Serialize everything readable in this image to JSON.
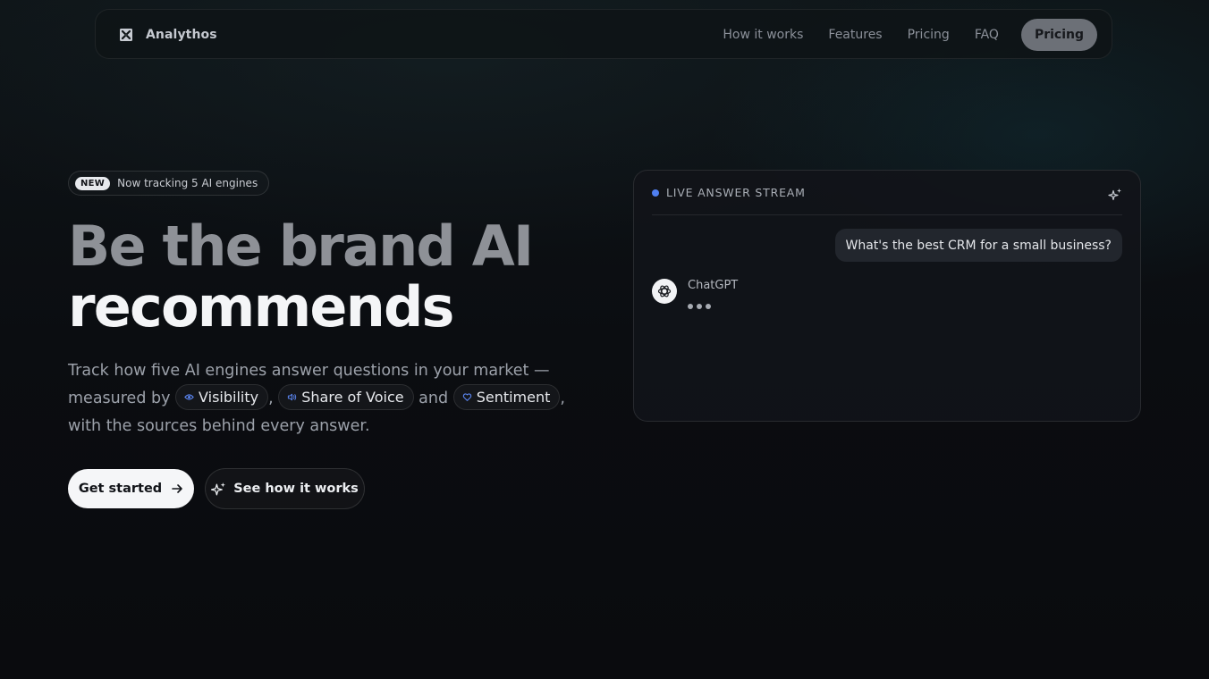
{
  "nav": {
    "brand": "Analythos",
    "brand_icon": "logo-icon",
    "links": [
      "How it works",
      "Features",
      "Pricing",
      "FAQ"
    ],
    "cta": "Pricing"
  },
  "hero": {
    "badge_pill": "NEW",
    "badge_text": "Now tracking 5 AI engines",
    "headline_line1": "Be the brand AI",
    "headline_line2": "recommends",
    "desc_part1": "Track how five AI engines answer questions in your market — measured by ",
    "chip_visibility": "Visibility",
    "sep1": ",",
    "chip_share": "Share of Voice",
    "and": "and",
    "chip_sentiment": "Sentiment",
    "desc_part2": ", with the sources behind every answer.",
    "primary_button": "Get started",
    "secondary_button": "See how it works"
  },
  "panel": {
    "title": "LIVE ANSWER STREAM",
    "question": "What's the best CRM for a small business?",
    "engine": "ChatGPT"
  },
  "colors": {
    "accent": "#4f7ff0",
    "background": "#0b0d11",
    "nav_cta_bg": "#6c7077",
    "primary_button_bg": "#f5f6f8"
  }
}
